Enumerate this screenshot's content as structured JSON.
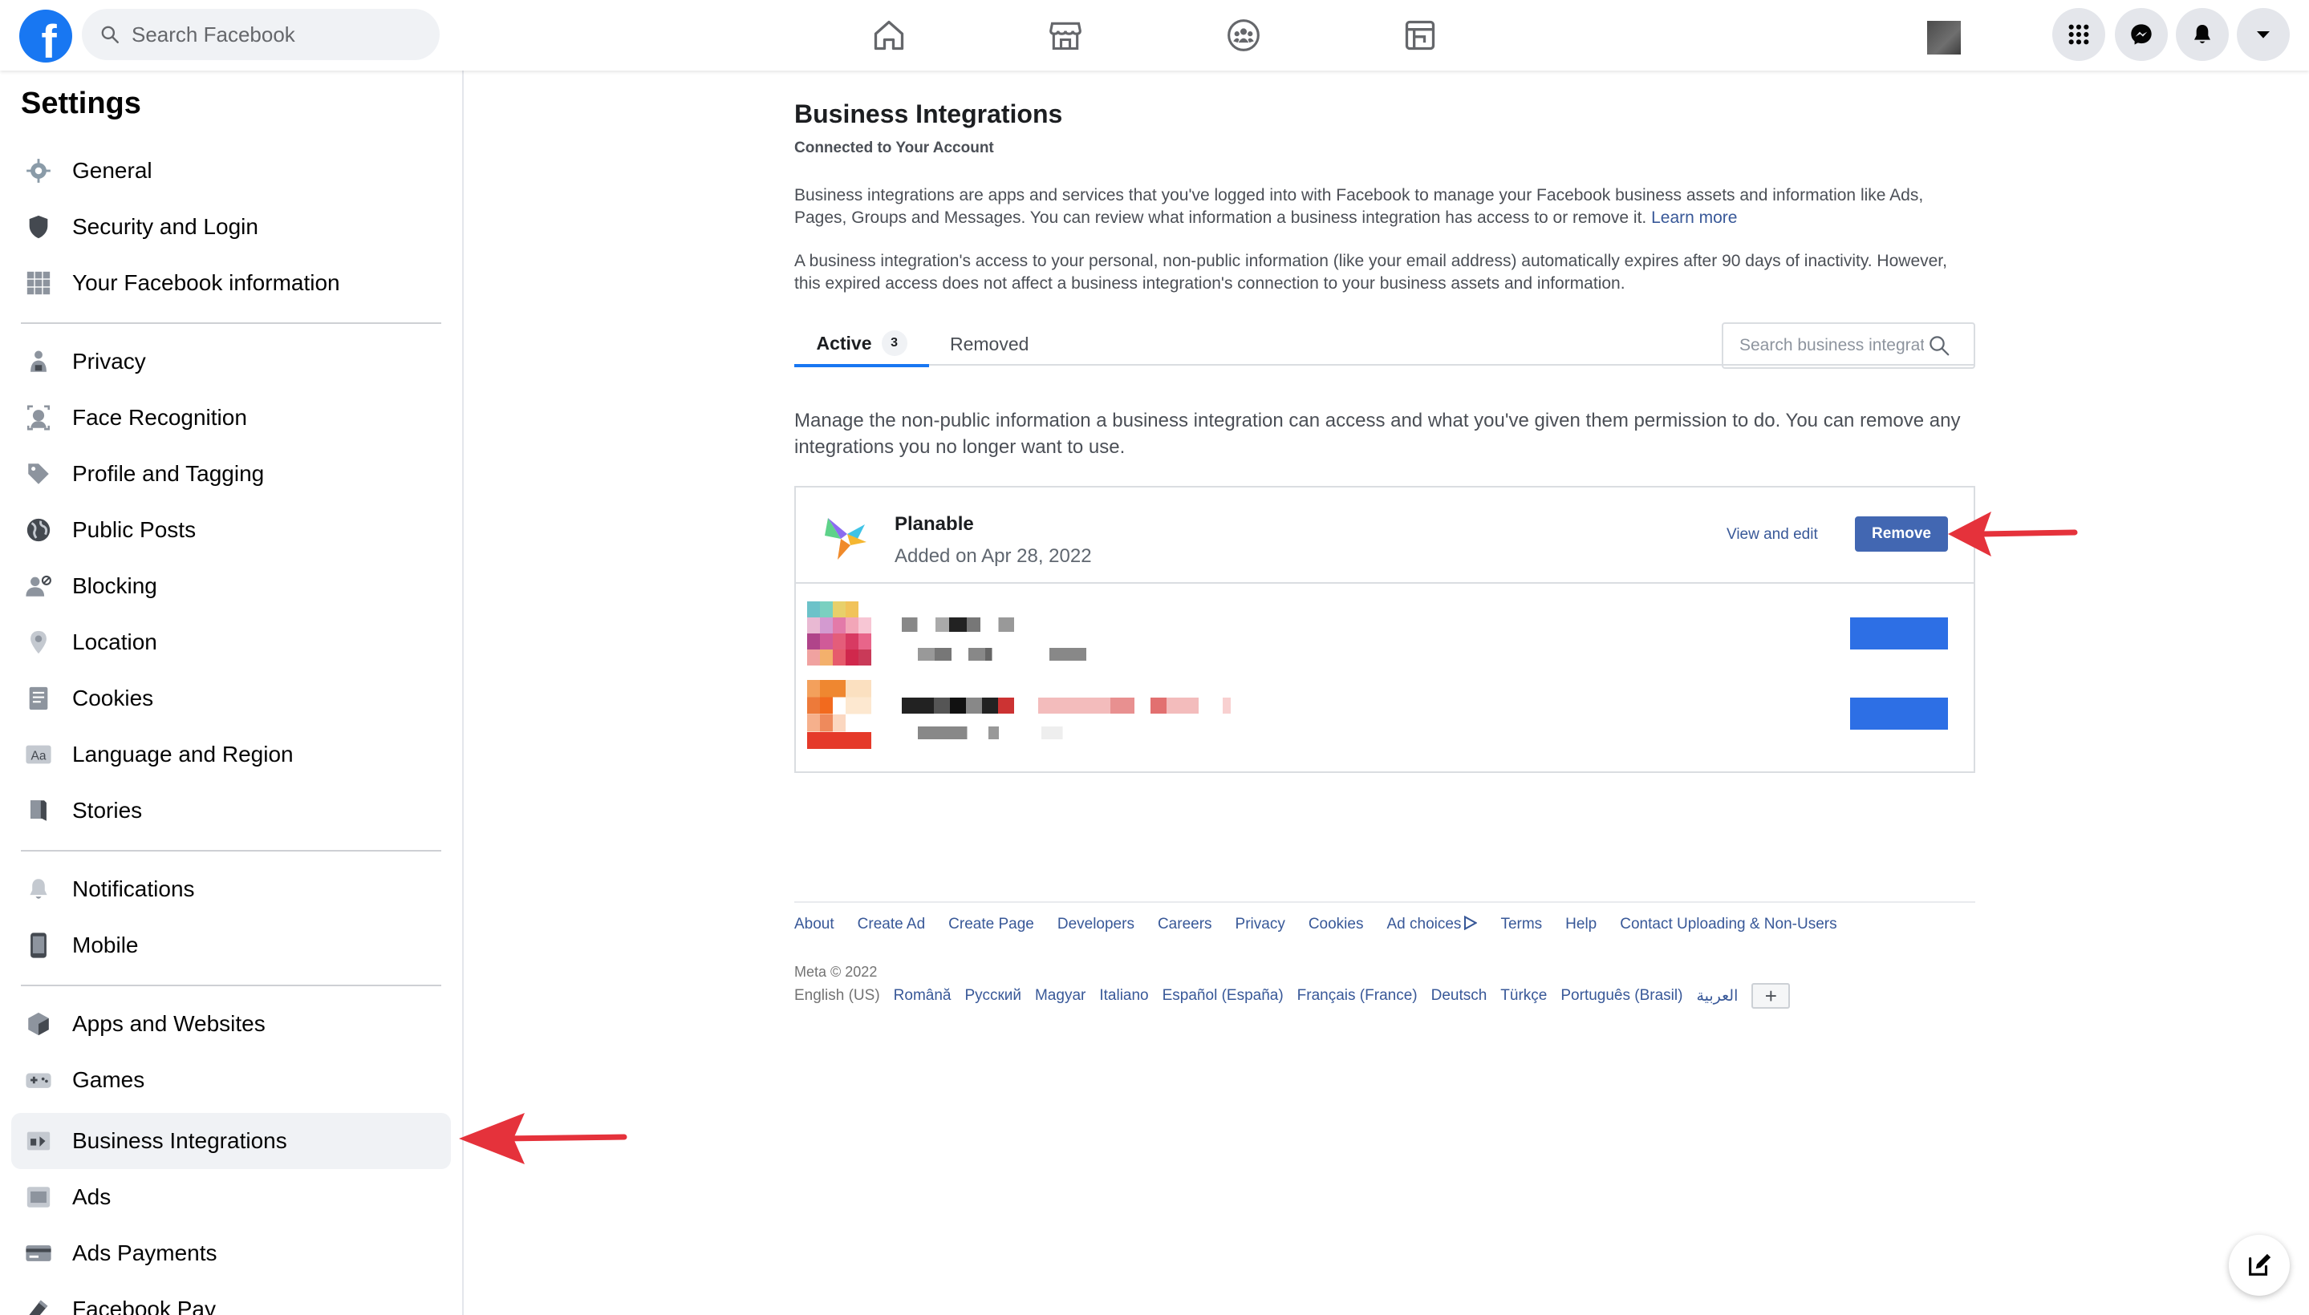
{
  "topbar": {
    "logo": "f",
    "search_placeholder": "Search Facebook",
    "icons": [
      "home-icon",
      "marketplace-icon",
      "groups-icon",
      "gaming-icon",
      "menu-grid-icon",
      "messenger-icon",
      "notifications-icon",
      "account-dropdown-icon"
    ]
  },
  "sidebar": {
    "title": "Settings",
    "items": [
      {
        "label": "General",
        "icon": "gear-icon"
      },
      {
        "label": "Security and Login",
        "icon": "shield-icon"
      },
      {
        "label": "Your Facebook information",
        "icon": "grid-icon"
      },
      {
        "label": "Privacy",
        "icon": "lock-icon"
      },
      {
        "label": "Face Recognition",
        "icon": "face-icon"
      },
      {
        "label": "Profile and Tagging",
        "icon": "tag-icon"
      },
      {
        "label": "Public Posts",
        "icon": "globe-icon"
      },
      {
        "label": "Blocking",
        "icon": "block-user-icon"
      },
      {
        "label": "Location",
        "icon": "location-pin-icon"
      },
      {
        "label": "Cookies",
        "icon": "cookies-icon"
      },
      {
        "label": "Language and Region",
        "icon": "language-icon"
      },
      {
        "label": "Stories",
        "icon": "book-icon"
      },
      {
        "label": "Notifications",
        "icon": "bell-icon"
      },
      {
        "label": "Mobile",
        "icon": "phone-icon"
      },
      {
        "label": "Apps and Websites",
        "icon": "cube-icon"
      },
      {
        "label": "Games",
        "icon": "gamepad-icon"
      },
      {
        "label": "Business Integrations",
        "icon": "puzzle-icon"
      },
      {
        "label": "Ads",
        "icon": "ads-icon"
      },
      {
        "label": "Ads Payments",
        "icon": "credit-card-icon"
      },
      {
        "label": "Facebook Pay",
        "icon": "pay-icon"
      }
    ],
    "active_item": "Business Integrations"
  },
  "main": {
    "title": "Business Integrations",
    "subtitle": "Connected to Your Account",
    "para1": "Business integrations are apps and services that you've logged into with Facebook to manage your Facebook business assets and information like Ads, Pages, Groups and Messages. You can review what information a business integration has access to or remove it.",
    "learn_more": "Learn more",
    "para2": "A business integration's access to your personal, non-public information (like your email address) automatically expires after 90 days of inactivity. However, this expired access does not affect a business integration's connection to your business assets and information.",
    "tabs": {
      "active_label": "Active",
      "active_count": "3",
      "removed_label": "Removed"
    },
    "search_placeholder": "Search business integrations",
    "manage_text": "Manage the non-public information a business integration can access and what you've given them permission to do. You can remove any integrations you no longer want to use.",
    "integrations": [
      {
        "name": "Planable",
        "added": "Added on Apr 28, 2022",
        "view_edit": "View and edit",
        "remove": "Remove"
      }
    ]
  },
  "footer": {
    "links": [
      "About",
      "Create Ad",
      "Create Page",
      "Developers",
      "Careers",
      "Privacy",
      "Cookies",
      "Ad choices",
      "Terms",
      "Help",
      "Contact Uploading & Non-Users"
    ],
    "meta": "Meta © 2022",
    "current_language": "English (US)",
    "languages": [
      "Română",
      "Русский",
      "Magyar",
      "Italiano",
      "Español (España)",
      "Français (France)",
      "Deutsch",
      "Türkçe",
      "Português (Brasil)",
      "العربية"
    ],
    "plus": "+"
  },
  "colors": {
    "brand": "#1877f2",
    "link": "#385898",
    "button": "#4267b2",
    "annotation_arrow": "#e5323b"
  }
}
